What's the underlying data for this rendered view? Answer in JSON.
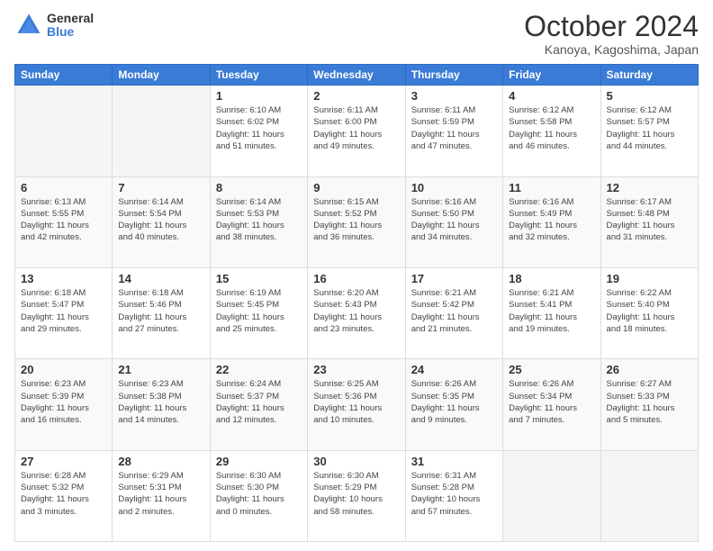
{
  "logo": {
    "general": "General",
    "blue": "Blue"
  },
  "title": "October 2024",
  "subtitle": "Kanoya, Kagoshima, Japan",
  "days_of_week": [
    "Sunday",
    "Monday",
    "Tuesday",
    "Wednesday",
    "Thursday",
    "Friday",
    "Saturday"
  ],
  "weeks": [
    [
      {
        "day": null,
        "info": null
      },
      {
        "day": null,
        "info": null
      },
      {
        "day": "1",
        "info": "Sunrise: 6:10 AM\nSunset: 6:02 PM\nDaylight: 11 hours\nand 51 minutes."
      },
      {
        "day": "2",
        "info": "Sunrise: 6:11 AM\nSunset: 6:00 PM\nDaylight: 11 hours\nand 49 minutes."
      },
      {
        "day": "3",
        "info": "Sunrise: 6:11 AM\nSunset: 5:59 PM\nDaylight: 11 hours\nand 47 minutes."
      },
      {
        "day": "4",
        "info": "Sunrise: 6:12 AM\nSunset: 5:58 PM\nDaylight: 11 hours\nand 46 minutes."
      },
      {
        "day": "5",
        "info": "Sunrise: 6:12 AM\nSunset: 5:57 PM\nDaylight: 11 hours\nand 44 minutes."
      }
    ],
    [
      {
        "day": "6",
        "info": "Sunrise: 6:13 AM\nSunset: 5:55 PM\nDaylight: 11 hours\nand 42 minutes."
      },
      {
        "day": "7",
        "info": "Sunrise: 6:14 AM\nSunset: 5:54 PM\nDaylight: 11 hours\nand 40 minutes."
      },
      {
        "day": "8",
        "info": "Sunrise: 6:14 AM\nSunset: 5:53 PM\nDaylight: 11 hours\nand 38 minutes."
      },
      {
        "day": "9",
        "info": "Sunrise: 6:15 AM\nSunset: 5:52 PM\nDaylight: 11 hours\nand 36 minutes."
      },
      {
        "day": "10",
        "info": "Sunrise: 6:16 AM\nSunset: 5:50 PM\nDaylight: 11 hours\nand 34 minutes."
      },
      {
        "day": "11",
        "info": "Sunrise: 6:16 AM\nSunset: 5:49 PM\nDaylight: 11 hours\nand 32 minutes."
      },
      {
        "day": "12",
        "info": "Sunrise: 6:17 AM\nSunset: 5:48 PM\nDaylight: 11 hours\nand 31 minutes."
      }
    ],
    [
      {
        "day": "13",
        "info": "Sunrise: 6:18 AM\nSunset: 5:47 PM\nDaylight: 11 hours\nand 29 minutes."
      },
      {
        "day": "14",
        "info": "Sunrise: 6:18 AM\nSunset: 5:46 PM\nDaylight: 11 hours\nand 27 minutes."
      },
      {
        "day": "15",
        "info": "Sunrise: 6:19 AM\nSunset: 5:45 PM\nDaylight: 11 hours\nand 25 minutes."
      },
      {
        "day": "16",
        "info": "Sunrise: 6:20 AM\nSunset: 5:43 PM\nDaylight: 11 hours\nand 23 minutes."
      },
      {
        "day": "17",
        "info": "Sunrise: 6:21 AM\nSunset: 5:42 PM\nDaylight: 11 hours\nand 21 minutes."
      },
      {
        "day": "18",
        "info": "Sunrise: 6:21 AM\nSunset: 5:41 PM\nDaylight: 11 hours\nand 19 minutes."
      },
      {
        "day": "19",
        "info": "Sunrise: 6:22 AM\nSunset: 5:40 PM\nDaylight: 11 hours\nand 18 minutes."
      }
    ],
    [
      {
        "day": "20",
        "info": "Sunrise: 6:23 AM\nSunset: 5:39 PM\nDaylight: 11 hours\nand 16 minutes."
      },
      {
        "day": "21",
        "info": "Sunrise: 6:23 AM\nSunset: 5:38 PM\nDaylight: 11 hours\nand 14 minutes."
      },
      {
        "day": "22",
        "info": "Sunrise: 6:24 AM\nSunset: 5:37 PM\nDaylight: 11 hours\nand 12 minutes."
      },
      {
        "day": "23",
        "info": "Sunrise: 6:25 AM\nSunset: 5:36 PM\nDaylight: 11 hours\nand 10 minutes."
      },
      {
        "day": "24",
        "info": "Sunrise: 6:26 AM\nSunset: 5:35 PM\nDaylight: 11 hours\nand 9 minutes."
      },
      {
        "day": "25",
        "info": "Sunrise: 6:26 AM\nSunset: 5:34 PM\nDaylight: 11 hours\nand 7 minutes."
      },
      {
        "day": "26",
        "info": "Sunrise: 6:27 AM\nSunset: 5:33 PM\nDaylight: 11 hours\nand 5 minutes."
      }
    ],
    [
      {
        "day": "27",
        "info": "Sunrise: 6:28 AM\nSunset: 5:32 PM\nDaylight: 11 hours\nand 3 minutes."
      },
      {
        "day": "28",
        "info": "Sunrise: 6:29 AM\nSunset: 5:31 PM\nDaylight: 11 hours\nand 2 minutes."
      },
      {
        "day": "29",
        "info": "Sunrise: 6:30 AM\nSunset: 5:30 PM\nDaylight: 11 hours\nand 0 minutes."
      },
      {
        "day": "30",
        "info": "Sunrise: 6:30 AM\nSunset: 5:29 PM\nDaylight: 10 hours\nand 58 minutes."
      },
      {
        "day": "31",
        "info": "Sunrise: 6:31 AM\nSunset: 5:28 PM\nDaylight: 10 hours\nand 57 minutes."
      },
      {
        "day": null,
        "info": null
      },
      {
        "day": null,
        "info": null
      }
    ]
  ]
}
